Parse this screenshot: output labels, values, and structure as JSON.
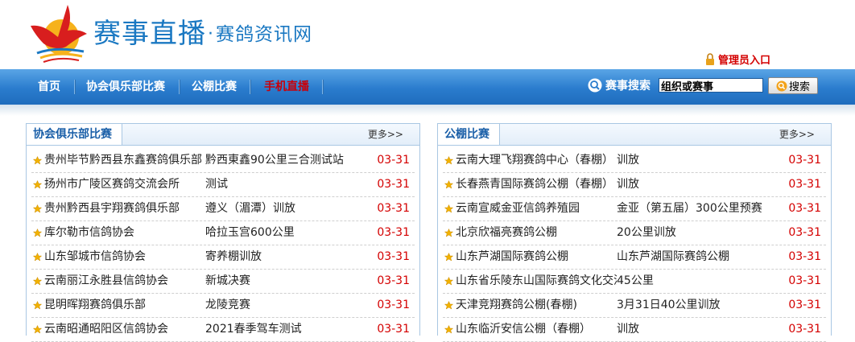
{
  "header": {
    "brand_main": "赛事直播",
    "brand_dot": "·",
    "brand_sub": "赛鸽资讯网",
    "admin_link": "管理员入口"
  },
  "nav": {
    "items": [
      {
        "label": "首页",
        "active": false
      },
      {
        "label": "协会俱乐部比赛",
        "active": false
      },
      {
        "label": "公棚比赛",
        "active": false
      },
      {
        "label": "手机直播",
        "active": true
      }
    ]
  },
  "search": {
    "label": "赛事搜索",
    "value": "组织或赛事",
    "button": "搜索"
  },
  "colors": {
    "accent": "#1a78c2",
    "nav_active": "#c8000a",
    "date": "#d40000"
  },
  "panels": [
    {
      "title": "协会俱乐部比赛",
      "more": "更多>>",
      "rows": [
        {
          "org": "贵州毕节黔西县东鑫赛鸽俱乐部",
          "event": "黔西東鑫90公里三合测试站",
          "date": "03-31"
        },
        {
          "org": "扬州市广陵区赛鸽交流会所",
          "event": "测试",
          "date": "03-31"
        },
        {
          "org": "贵州黔西县宇翔赛鸽俱乐部",
          "event": "遵义（湄潭）训放",
          "date": "03-31"
        },
        {
          "org": "库尔勒市信鸽协会",
          "event": "哈拉玉宫600公里",
          "date": "03-31"
        },
        {
          "org": "山东邹城市信鸽协会",
          "event": "寄养棚训放",
          "date": "03-31"
        },
        {
          "org": "云南丽江永胜县信鸽协会",
          "event": "新城决赛",
          "date": "03-31"
        },
        {
          "org": "昆明晖翔赛鸽俱乐部",
          "event": "龙陵竞赛",
          "date": "03-31"
        },
        {
          "org": "云南昭通昭阳区信鸽协会",
          "event": "2021春季驾车测试",
          "date": "03-31"
        }
      ]
    },
    {
      "title": "公棚比赛",
      "more": "更多>>",
      "rows": [
        {
          "org": "云南大理飞翔赛鸽中心（春棚）",
          "event": "训放",
          "date": "03-31"
        },
        {
          "org": "长春燕青国际赛鸽公棚（春棚）",
          "event": "训放",
          "date": "03-31"
        },
        {
          "org": "云南宣威金亚信鸽养殖园",
          "event": "金亚（第五届）300公里预赛",
          "date": "03-31"
        },
        {
          "org": "北京欣福亮赛鸽公棚",
          "event": "20公里训放",
          "date": "03-31"
        },
        {
          "org": "山东芦湖国际赛鸽公棚",
          "event": "山东芦湖国际赛鸽公棚",
          "date": "03-31"
        },
        {
          "org": "山东省乐陵东山国际赛鸽文化交流",
          "event": "45公里",
          "date": "03-31"
        },
        {
          "org": "天津竞翔赛鸽公棚(春棚)",
          "event": "3月31日40公里训放",
          "date": "03-31"
        },
        {
          "org": "山东临沂安信公棚（春棚）",
          "event": "训放",
          "date": "03-31"
        }
      ]
    }
  ]
}
